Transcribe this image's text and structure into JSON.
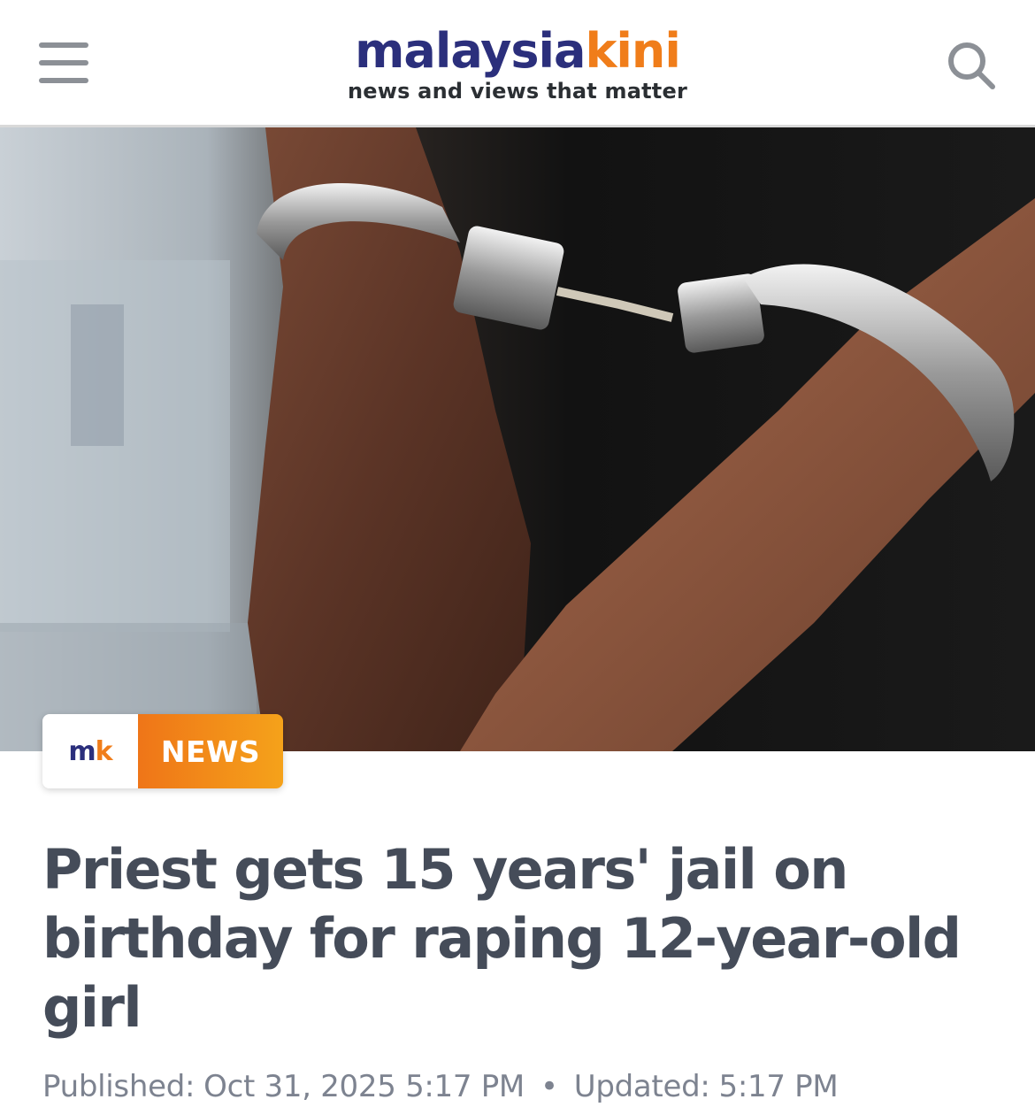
{
  "header": {
    "logo_part1": "malaysia",
    "logo_part2": "kini",
    "tagline": "news and views that matter",
    "menu_icon": "hamburger-menu-icon",
    "search_icon": "search-icon"
  },
  "badge": {
    "logo_m": "m",
    "logo_k": "k",
    "label": "NEWS"
  },
  "article": {
    "headline": "Priest gets 15 years' jail on birthday for raping 12-year-old girl",
    "published_label": "Published:",
    "published_value": "Oct 31, 2025 5:17 PM",
    "separator": "•",
    "updated_label": "Updated:",
    "updated_value": "5:17 PM"
  },
  "colors": {
    "brand_navy": "#2b2f7c",
    "brand_orange": "#f07d1a",
    "headline": "#454c59",
    "meta": "#7d8390"
  }
}
